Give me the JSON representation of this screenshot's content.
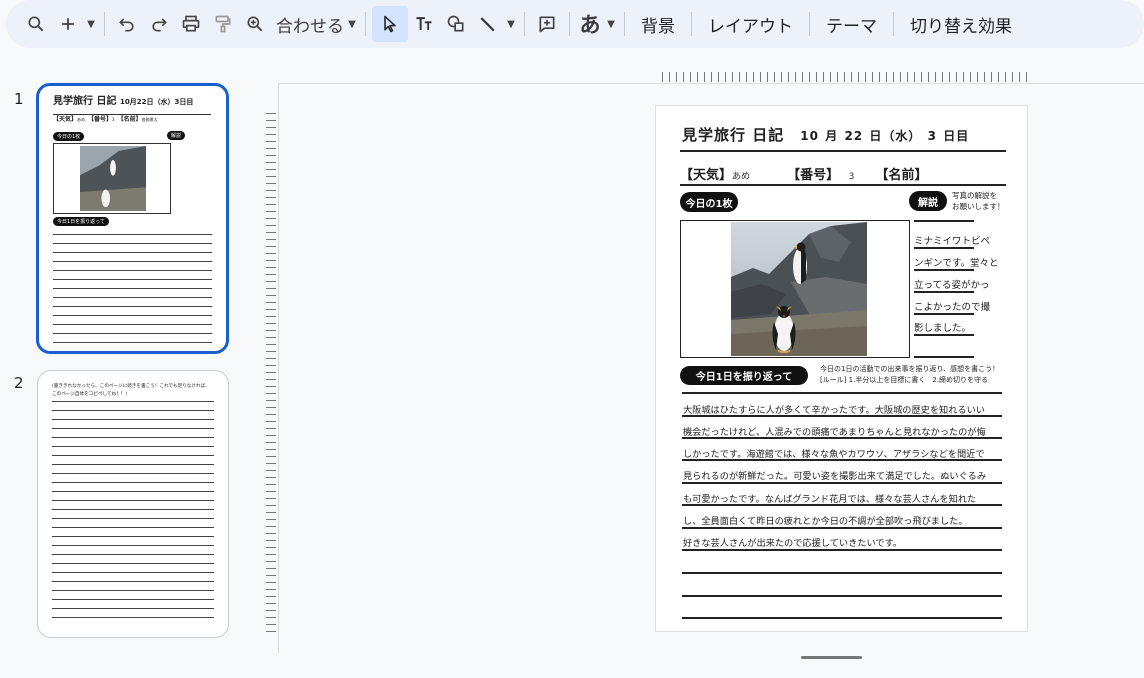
{
  "toolbar": {
    "zoom_label": "合わせる",
    "font_style_label": "あ",
    "background_label": "背景",
    "layout_label": "レイアウト",
    "theme_label": "テーマ",
    "transition_label": "切り替え効果"
  },
  "filmstrip": {
    "slide_numbers": [
      "1",
      "2"
    ],
    "slide2_note": "(書ききれなかったら、このページに続きを書こう！これでも足りなければ、このページ自体をコピペしてね！！)"
  },
  "slide": {
    "title": "見学旅行 日記",
    "date_month": "10",
    "month_unit": "月",
    "date_day": "22",
    "day_unit": "日",
    "weekday": "（水）",
    "day_count": "3",
    "day_count_unit": "日目",
    "weather_label": "【天気】",
    "weather_value": "あめ",
    "number_label": "【番号】",
    "number_value": "3",
    "name_label": "【名前】",
    "name_value": "各務景太",
    "photo_pill": "今日の1枚",
    "explain_pill": "解説",
    "explain_note_1": "写真の解説を",
    "explain_note_2": "お願いします！",
    "caption_lines": [
      "ミナミイワトビペ",
      "ンギンです。堂々と",
      "立ってる姿がかっ",
      "こよかったので撮",
      "影しました。"
    ],
    "reflect_pill": "今日1日を振り返って",
    "reflect_note_1": "今日の1日の活動での出来事を振り返り、感想を書こう！",
    "reflect_note_2": "[ルール] 1.半分以上を目標に書く　2.締め切りを守る",
    "body_lines": [
      "大阪城はひたすらに人が多くて辛かったです。大阪城の歴史を知れるいい",
      "機会だったけれど、人混みでの頭痛であまりちゃんと見れなかったのが悔",
      "しかったです。海遊館では、様々な魚やカワウソ、アザラシなどを間近で",
      "見られるのが新鮮だった。可愛い姿を撮影出来て満足でした。ぬいぐるみ",
      "も可愛かったです。なんばグランド花月では、様々な芸人さんを知れた",
      "し、全員面白くて昨日の疲れとか今日の不調が全部吹っ飛びました。",
      "好きな芸人さんが出来たので応援していきたいです。"
    ]
  },
  "colors": {
    "accent": "#1a5fd0",
    "toolbar_bg": "#edf1f9",
    "active_tool": "#d3e3fd"
  }
}
